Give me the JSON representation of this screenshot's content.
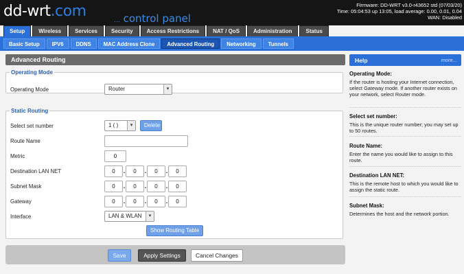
{
  "header": {
    "logo_main": "dd-wrt",
    "logo_dot": ".",
    "logo_suffix": "com",
    "control_panel_dots": "...",
    "control_panel": "control panel",
    "firmware": "Firmware: DD-WRT v3.0-r43652 std (07/03/20)",
    "time": "Time: 05:04:53 up 13:05, load average: 0.00, 0.01, 0.04",
    "wan": "WAN: Disabled"
  },
  "main_tabs": [
    {
      "label": "Setup",
      "active": true
    },
    {
      "label": "Wireless"
    },
    {
      "label": "Services"
    },
    {
      "label": "Security"
    },
    {
      "label": "Access Restrictions"
    },
    {
      "label": "NAT / QoS"
    },
    {
      "label": "Administration"
    },
    {
      "label": "Status"
    }
  ],
  "sub_tabs": [
    {
      "label": "Basic Setup"
    },
    {
      "label": "IPV6"
    },
    {
      "label": "DDNS"
    },
    {
      "label": "MAC Address Clone"
    },
    {
      "label": "Advanced Routing",
      "active": true
    },
    {
      "label": "Networking"
    },
    {
      "label": "Tunnels"
    }
  ],
  "content": {
    "title": "Advanced Routing",
    "operating_mode": {
      "legend": "Operating Mode",
      "label": "Operating Mode",
      "value": "Router"
    },
    "static_routing": {
      "legend": "Static Routing",
      "set_number_label": "Select set number",
      "set_number_value": "1 ( )",
      "delete_label": "Delete",
      "route_name_label": "Route Name",
      "route_name_value": "",
      "metric_label": "Metric",
      "metric_value": "0",
      "dest_label": "Destination LAN NET",
      "dest_ip": [
        "0",
        "0",
        "0",
        "0"
      ],
      "mask_label": "Subnet Mask",
      "mask_ip": [
        "0",
        "0",
        "0",
        "0"
      ],
      "gateway_label": "Gateway",
      "gateway_ip": [
        "0",
        "0",
        "0",
        "0"
      ],
      "interface_label": "Interface",
      "interface_value": "LAN & WLAN",
      "show_table_label": "Show Routing Table"
    }
  },
  "footer": {
    "save": "Save",
    "apply": "Apply Settings",
    "cancel": "Cancel Changes"
  },
  "help": {
    "title": "Help",
    "more": "more...",
    "sections": [
      {
        "title": "Operating Mode:",
        "body": "If the router is hosting your Internet connection, select Gateway mode. If another router exists on your network, select Router mode."
      },
      {
        "title": "Select set number:",
        "body": "This is the unique router number; you may set up to 50 routes."
      },
      {
        "title": "Route Name:",
        "body": "Enter the name you would like to assign to this route."
      },
      {
        "title": "Destination LAN NET:",
        "body": "This is the remote host to which you would like to assign the static route."
      },
      {
        "title": "Subnet Mask:",
        "body": "Determines the host and the network portion."
      }
    ]
  },
  "colors": {
    "header_bg": "#151515",
    "accent_blue": "#2a70d8",
    "legend_blue": "#2a5fb0",
    "panel_title_bg": "#6b6b6b"
  }
}
